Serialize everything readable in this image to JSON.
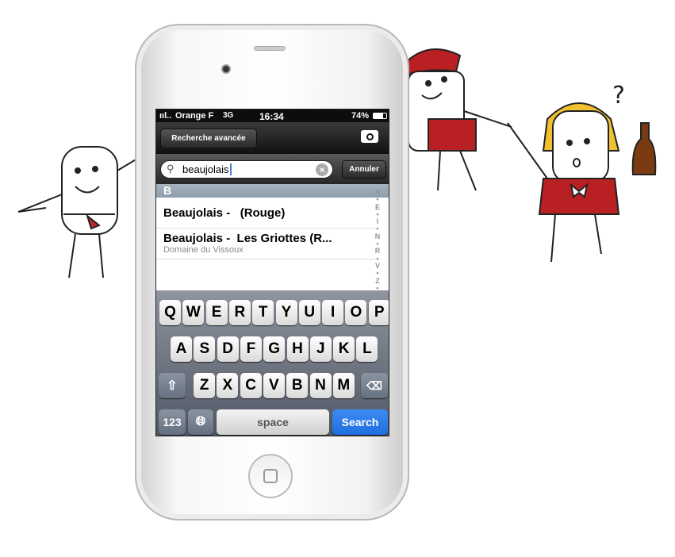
{
  "status": {
    "carrier": "Orange F",
    "network": "3G",
    "time": "16:34",
    "battery": "74%",
    "battery_level": 0.74
  },
  "nav": {
    "advanced_search": "Recherche avancée",
    "camera_icon": "camera-icon"
  },
  "search": {
    "value": "beaujolais",
    "cancel": "Annuler"
  },
  "section": "B",
  "results": [
    {
      "title": "Beaujolais -   (Rouge)",
      "subtitle": ""
    },
    {
      "title": "Beaujolais -  Les Griottes (R...",
      "subtitle": "Domaine du Vissoux"
    }
  ],
  "index": [
    "A",
    "•",
    "E",
    "•",
    "I",
    "•",
    "N",
    "•",
    "R",
    "•",
    "V",
    "•",
    "Z",
    "•",
    "Z"
  ],
  "keyboard": {
    "row1": [
      "Q",
      "W",
      "E",
      "R",
      "T",
      "Y",
      "U",
      "I",
      "O",
      "P"
    ],
    "row2": [
      "A",
      "S",
      "D",
      "F",
      "G",
      "H",
      "J",
      "K",
      "L"
    ],
    "row3": [
      "Z",
      "X",
      "C",
      "V",
      "B",
      "N",
      "M"
    ],
    "numbers": "123",
    "space": "space",
    "search": "Search"
  },
  "colors": {
    "accent": "#1f6fe0"
  }
}
